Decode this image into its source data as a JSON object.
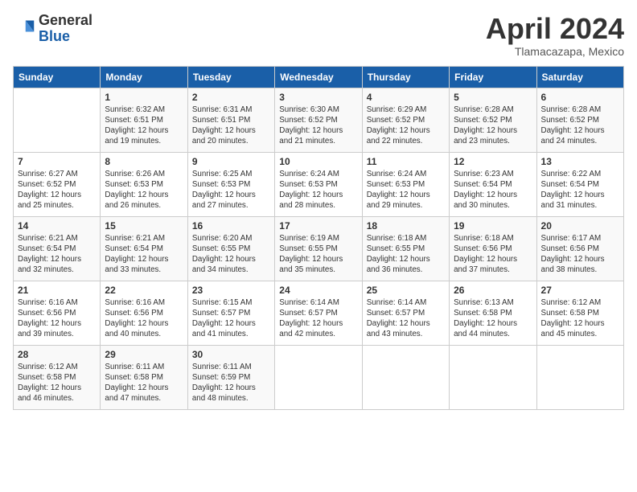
{
  "header": {
    "logo_line1": "General",
    "logo_line2": "Blue",
    "month_year": "April 2024",
    "location": "Tlamacazapa, Mexico"
  },
  "columns": [
    "Sunday",
    "Monday",
    "Tuesday",
    "Wednesday",
    "Thursday",
    "Friday",
    "Saturday"
  ],
  "weeks": [
    [
      {
        "day": "",
        "sunrise": "",
        "sunset": "",
        "daylight": ""
      },
      {
        "day": "1",
        "sunrise": "Sunrise: 6:32 AM",
        "sunset": "Sunset: 6:51 PM",
        "daylight": "Daylight: 12 hours and 19 minutes."
      },
      {
        "day": "2",
        "sunrise": "Sunrise: 6:31 AM",
        "sunset": "Sunset: 6:51 PM",
        "daylight": "Daylight: 12 hours and 20 minutes."
      },
      {
        "day": "3",
        "sunrise": "Sunrise: 6:30 AM",
        "sunset": "Sunset: 6:52 PM",
        "daylight": "Daylight: 12 hours and 21 minutes."
      },
      {
        "day": "4",
        "sunrise": "Sunrise: 6:29 AM",
        "sunset": "Sunset: 6:52 PM",
        "daylight": "Daylight: 12 hours and 22 minutes."
      },
      {
        "day": "5",
        "sunrise": "Sunrise: 6:28 AM",
        "sunset": "Sunset: 6:52 PM",
        "daylight": "Daylight: 12 hours and 23 minutes."
      },
      {
        "day": "6",
        "sunrise": "Sunrise: 6:28 AM",
        "sunset": "Sunset: 6:52 PM",
        "daylight": "Daylight: 12 hours and 24 minutes."
      }
    ],
    [
      {
        "day": "7",
        "sunrise": "Sunrise: 6:27 AM",
        "sunset": "Sunset: 6:52 PM",
        "daylight": "Daylight: 12 hours and 25 minutes."
      },
      {
        "day": "8",
        "sunrise": "Sunrise: 6:26 AM",
        "sunset": "Sunset: 6:53 PM",
        "daylight": "Daylight: 12 hours and 26 minutes."
      },
      {
        "day": "9",
        "sunrise": "Sunrise: 6:25 AM",
        "sunset": "Sunset: 6:53 PM",
        "daylight": "Daylight: 12 hours and 27 minutes."
      },
      {
        "day": "10",
        "sunrise": "Sunrise: 6:24 AM",
        "sunset": "Sunset: 6:53 PM",
        "daylight": "Daylight: 12 hours and 28 minutes."
      },
      {
        "day": "11",
        "sunrise": "Sunrise: 6:24 AM",
        "sunset": "Sunset: 6:53 PM",
        "daylight": "Daylight: 12 hours and 29 minutes."
      },
      {
        "day": "12",
        "sunrise": "Sunrise: 6:23 AM",
        "sunset": "Sunset: 6:54 PM",
        "daylight": "Daylight: 12 hours and 30 minutes."
      },
      {
        "day": "13",
        "sunrise": "Sunrise: 6:22 AM",
        "sunset": "Sunset: 6:54 PM",
        "daylight": "Daylight: 12 hours and 31 minutes."
      }
    ],
    [
      {
        "day": "14",
        "sunrise": "Sunrise: 6:21 AM",
        "sunset": "Sunset: 6:54 PM",
        "daylight": "Daylight: 12 hours and 32 minutes."
      },
      {
        "day": "15",
        "sunrise": "Sunrise: 6:21 AM",
        "sunset": "Sunset: 6:54 PM",
        "daylight": "Daylight: 12 hours and 33 minutes."
      },
      {
        "day": "16",
        "sunrise": "Sunrise: 6:20 AM",
        "sunset": "Sunset: 6:55 PM",
        "daylight": "Daylight: 12 hours and 34 minutes."
      },
      {
        "day": "17",
        "sunrise": "Sunrise: 6:19 AM",
        "sunset": "Sunset: 6:55 PM",
        "daylight": "Daylight: 12 hours and 35 minutes."
      },
      {
        "day": "18",
        "sunrise": "Sunrise: 6:18 AM",
        "sunset": "Sunset: 6:55 PM",
        "daylight": "Daylight: 12 hours and 36 minutes."
      },
      {
        "day": "19",
        "sunrise": "Sunrise: 6:18 AM",
        "sunset": "Sunset: 6:56 PM",
        "daylight": "Daylight: 12 hours and 37 minutes."
      },
      {
        "day": "20",
        "sunrise": "Sunrise: 6:17 AM",
        "sunset": "Sunset: 6:56 PM",
        "daylight": "Daylight: 12 hours and 38 minutes."
      }
    ],
    [
      {
        "day": "21",
        "sunrise": "Sunrise: 6:16 AM",
        "sunset": "Sunset: 6:56 PM",
        "daylight": "Daylight: 12 hours and 39 minutes."
      },
      {
        "day": "22",
        "sunrise": "Sunrise: 6:16 AM",
        "sunset": "Sunset: 6:56 PM",
        "daylight": "Daylight: 12 hours and 40 minutes."
      },
      {
        "day": "23",
        "sunrise": "Sunrise: 6:15 AM",
        "sunset": "Sunset: 6:57 PM",
        "daylight": "Daylight: 12 hours and 41 minutes."
      },
      {
        "day": "24",
        "sunrise": "Sunrise: 6:14 AM",
        "sunset": "Sunset: 6:57 PM",
        "daylight": "Daylight: 12 hours and 42 minutes."
      },
      {
        "day": "25",
        "sunrise": "Sunrise: 6:14 AM",
        "sunset": "Sunset: 6:57 PM",
        "daylight": "Daylight: 12 hours and 43 minutes."
      },
      {
        "day": "26",
        "sunrise": "Sunrise: 6:13 AM",
        "sunset": "Sunset: 6:58 PM",
        "daylight": "Daylight: 12 hours and 44 minutes."
      },
      {
        "day": "27",
        "sunrise": "Sunrise: 6:12 AM",
        "sunset": "Sunset: 6:58 PM",
        "daylight": "Daylight: 12 hours and 45 minutes."
      }
    ],
    [
      {
        "day": "28",
        "sunrise": "Sunrise: 6:12 AM",
        "sunset": "Sunset: 6:58 PM",
        "daylight": "Daylight: 12 hours and 46 minutes."
      },
      {
        "day": "29",
        "sunrise": "Sunrise: 6:11 AM",
        "sunset": "Sunset: 6:58 PM",
        "daylight": "Daylight: 12 hours and 47 minutes."
      },
      {
        "day": "30",
        "sunrise": "Sunrise: 6:11 AM",
        "sunset": "Sunset: 6:59 PM",
        "daylight": "Daylight: 12 hours and 48 minutes."
      },
      {
        "day": "",
        "sunrise": "",
        "sunset": "",
        "daylight": ""
      },
      {
        "day": "",
        "sunrise": "",
        "sunset": "",
        "daylight": ""
      },
      {
        "day": "",
        "sunrise": "",
        "sunset": "",
        "daylight": ""
      },
      {
        "day": "",
        "sunrise": "",
        "sunset": "",
        "daylight": ""
      }
    ]
  ]
}
